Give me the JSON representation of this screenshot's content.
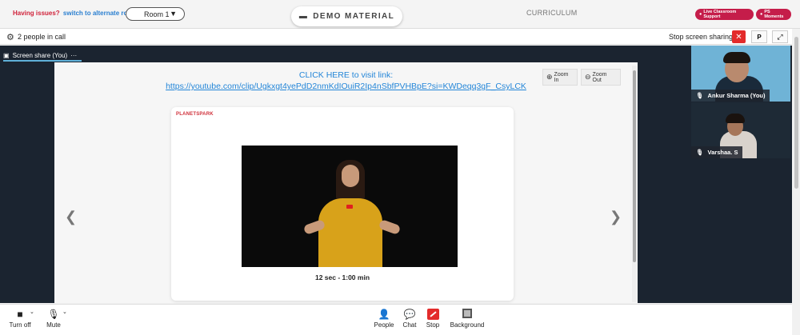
{
  "topbar": {
    "issues_text": "Having issues?",
    "alternate_link": "switch to alternate room",
    "room_select": "Room 1",
    "demo_material": "DEMO MATERIAL",
    "curriculum": "CURRICULUM",
    "live_support": "Live Classroom Support",
    "ps_moments": "PS Moments"
  },
  "toolbar": {
    "people_count": "2 people in call",
    "stop_sharing": "Stop screen sharing",
    "p_label": "P"
  },
  "share_tab": {
    "label": "Screen share (You)",
    "more": "···"
  },
  "shared_screen": {
    "link_cta": "CLICK HERE to visit link:",
    "link_url": "https://youtube.com/clip/Ugkxgt4yePdD2nmKdIOuiR2Ip4nSbfPVHBpE?si=KWDeqq3gF_CsyLCK",
    "zoom_in": "Zoom In",
    "zoom_out": "Zoom Out",
    "logo": "PLANETSPARK",
    "duration": "12 sec - 1:00 min"
  },
  "participants": [
    {
      "name": "Ankur Sharma (You)"
    },
    {
      "name": "Varshaa. S"
    }
  ],
  "controls": {
    "turn_off": "Turn off",
    "mute": "Mute",
    "people": "People",
    "chat": "Chat",
    "stop": "Stop",
    "background": "Background"
  },
  "colors": {
    "accent_red": "#c51d4a",
    "link_blue": "#2486d8",
    "stage_bg": "#1b2430"
  },
  "icons": [
    "gear-icon",
    "folder-icon",
    "close-icon",
    "expand-icon",
    "screen-icon",
    "zoom-in-icon",
    "zoom-out-icon",
    "chevron-left-icon",
    "chevron-right-icon",
    "mic-icon",
    "camera-icon",
    "person-icon",
    "chat-icon",
    "background-icon"
  ]
}
